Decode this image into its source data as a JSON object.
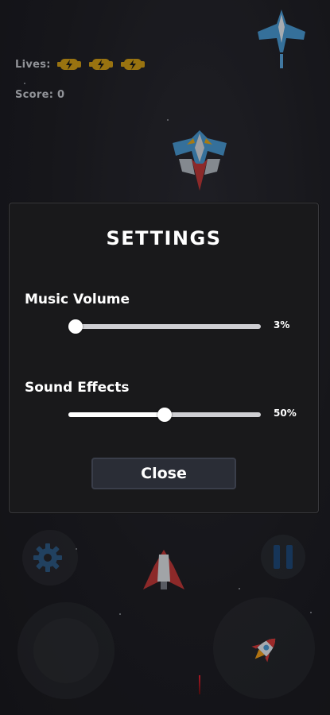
{
  "hud": {
    "lives_label": "Lives:",
    "lives_count": 3,
    "score_label": "Score: 0"
  },
  "settings": {
    "title": "SETTINGS",
    "music": {
      "label": "Music Volume",
      "value_text": "3%",
      "level": 0.03
    },
    "sfx": {
      "label": "Sound Effects",
      "value_text": "50%",
      "level": 0.5
    },
    "close_label": "Close"
  },
  "colors": {
    "background": "#1f1f25",
    "panel": "#19191b",
    "life_icon": "#d4a017",
    "pause_icon": "#1f4a7a"
  },
  "icons": {
    "life": "engine-icon",
    "settings": "gear-icon",
    "pause": "pause-icon",
    "fire": "rocket-icon"
  }
}
